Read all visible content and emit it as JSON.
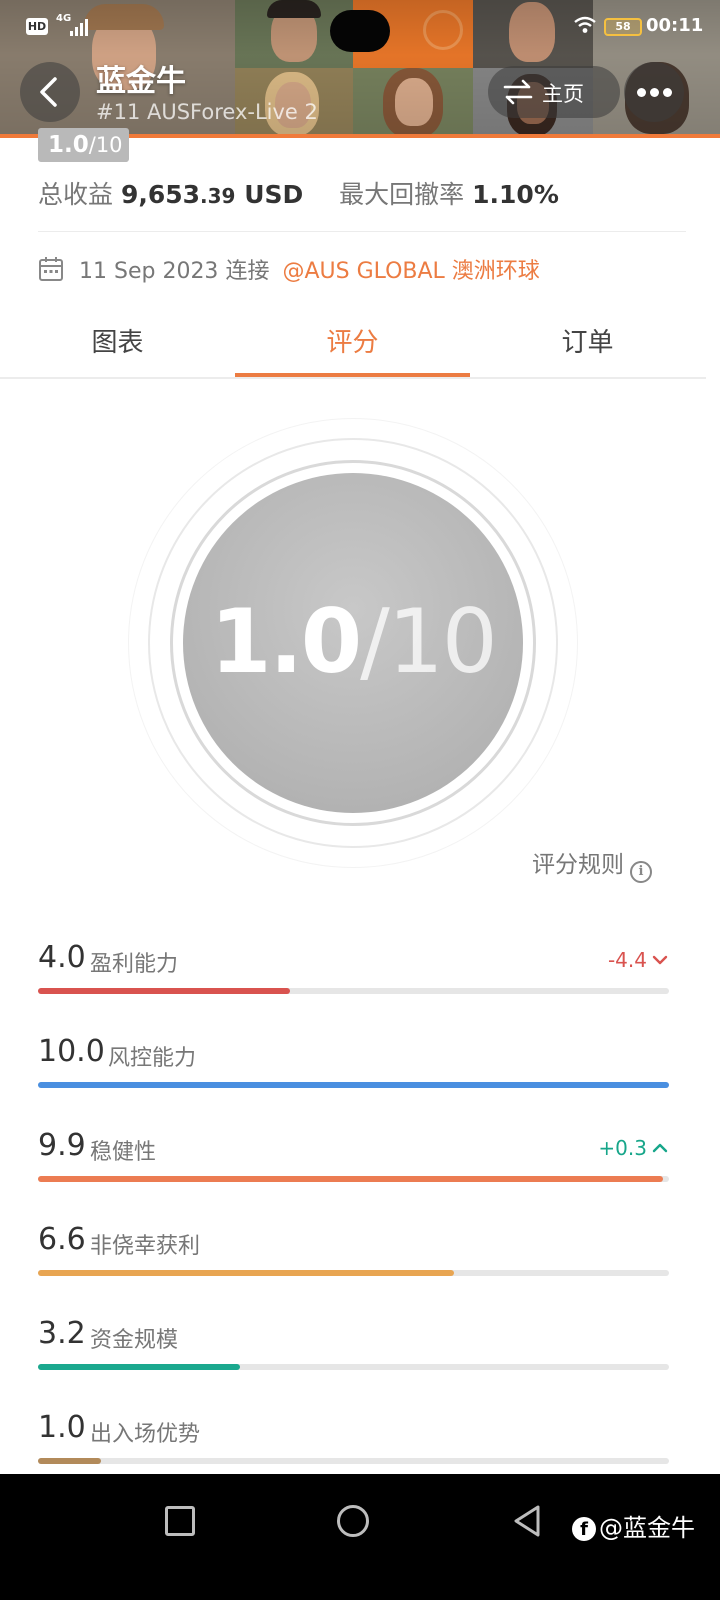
{
  "status_bar": {
    "hd_label": "HD",
    "network": "4G",
    "battery": "58",
    "time": "00:11"
  },
  "header": {
    "app_name": "蓝金牛",
    "account": "#11 AUSForex-Live 2",
    "home_label": "主页"
  },
  "summary": {
    "score_value": "1.0",
    "score_max": "/10",
    "profit_label": "总收益",
    "profit_int": "9,653",
    "profit_dec": ".39",
    "profit_unit": "USD",
    "drawdown_label": "最大回撤率",
    "drawdown_value": "1.10%"
  },
  "connection": {
    "date": "11 Sep 2023",
    "connect_text": "连接",
    "broker": "@AUS GLOBAL 澳洲环球"
  },
  "tabs": [
    {
      "label": "图表"
    },
    {
      "label": "评分"
    },
    {
      "label": "订单"
    }
  ],
  "active_tab": 1,
  "score": {
    "value": "1.0",
    "max": "/10"
  },
  "rules_label": "评分规则",
  "metrics": [
    {
      "value": "4.0",
      "name": "盈利能力",
      "delta": "-4.4",
      "delta_dir": "down",
      "level": 0.4,
      "color": "#d9534f"
    },
    {
      "value": "10.0",
      "name": "风控能力",
      "delta": "",
      "delta_dir": "",
      "level": 1.0,
      "color": "#4a8fe0"
    },
    {
      "value": "9.9",
      "name": "稳健性",
      "delta": "+0.3",
      "delta_dir": "up",
      "level": 0.99,
      "color": "#ec7c52"
    },
    {
      "value": "6.6",
      "name": "非侥幸获利",
      "delta": "",
      "delta_dir": "",
      "level": 0.66,
      "color": "#e8a552"
    },
    {
      "value": "3.2",
      "name": "资金规模",
      "delta": "",
      "delta_dir": "",
      "level": 0.32,
      "color": "#1aa88e"
    },
    {
      "value": "1.0",
      "name": "出入场优势",
      "delta": "",
      "delta_dir": "",
      "level": 0.1,
      "color": "#b28a5a"
    }
  ],
  "watermark": "@蓝金牛",
  "icons": {
    "back": "chevron-left-icon",
    "swap": "swap-icon",
    "more": "more-dots-icon",
    "calendar": "calendar-icon",
    "info": "info-icon"
  }
}
